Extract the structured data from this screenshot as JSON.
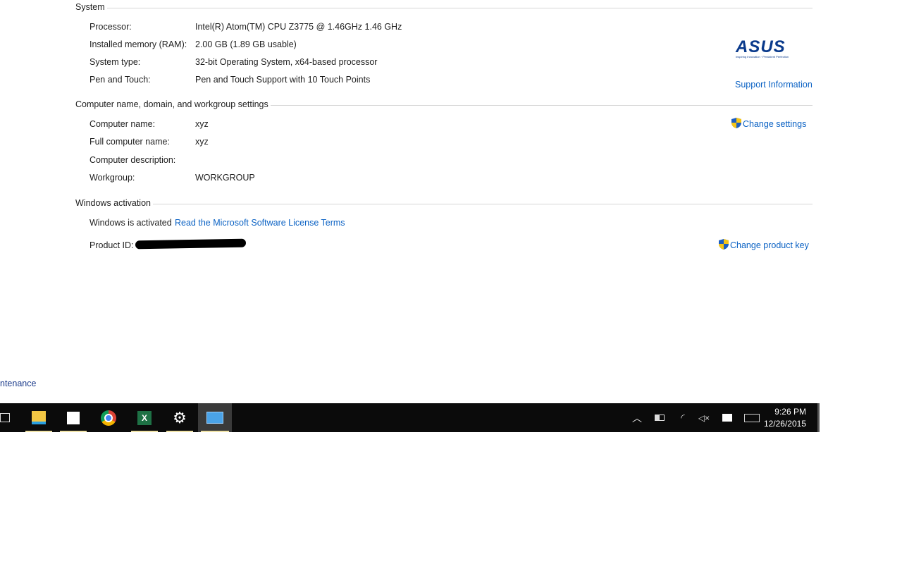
{
  "system": {
    "heading": "System",
    "rows": [
      {
        "label": "Processor:",
        "value": "Intel(R) Atom(TM) CPU  Z3775  @ 1.46GHz   1.46 GHz"
      },
      {
        "label": "Installed memory (RAM):",
        "value": "2.00 GB (1.89 GB usable)"
      },
      {
        "label": "System type:",
        "value": "32-bit Operating System, x64-based processor"
      },
      {
        "label": "Pen and Touch:",
        "value": "Pen and Touch Support with 10 Touch Points"
      }
    ],
    "logo": "ASUS",
    "logo_tagline": "Inspiring Innovation · Persistent Perfection",
    "support_link": "Support Information"
  },
  "computer": {
    "heading": "Computer name, domain, and workgroup settings",
    "rows": [
      {
        "label": "Computer name:",
        "value": "xyz"
      },
      {
        "label": "Full computer name:",
        "value": "xyz"
      },
      {
        "label": "Computer description:",
        "value": ""
      },
      {
        "label": "Workgroup:",
        "value": "WORKGROUP"
      }
    ],
    "change_settings": "Change settings"
  },
  "activation": {
    "heading": "Windows activation",
    "status": "Windows is activated",
    "license_link": "Read the Microsoft Software License Terms",
    "product_id_label": "Product ID:",
    "change_key": "Change product key"
  },
  "sidebar_partial_link": "ntenance",
  "taskbar": {
    "apps": [
      "task-view",
      "file-explorer",
      "store",
      "chrome",
      "excel",
      "settings",
      "control-panel"
    ],
    "clock_time": "9:26 PM",
    "clock_date": "12/26/2015",
    "accent": "#f0e3a8"
  }
}
